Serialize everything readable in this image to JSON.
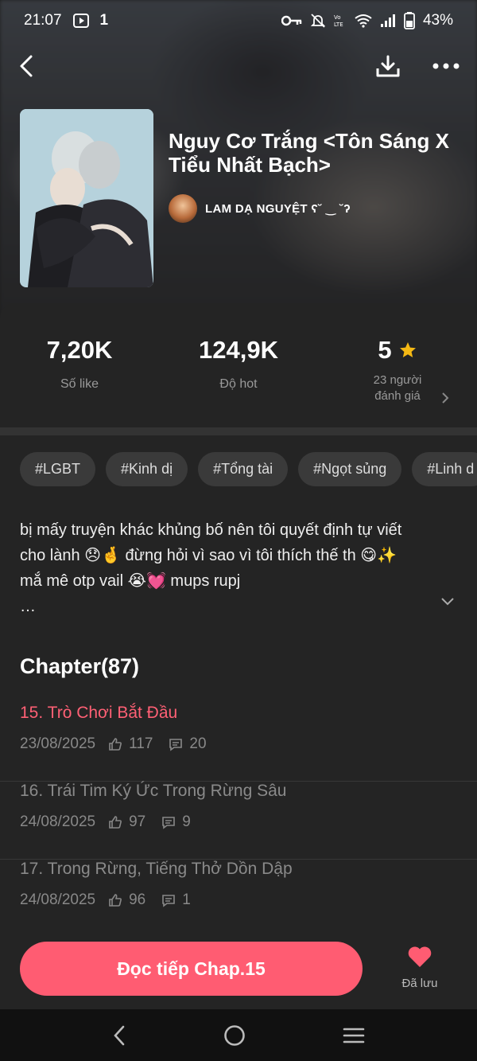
{
  "status_bar": {
    "time": "21:07",
    "notif_count": "1",
    "battery": "43%"
  },
  "book": {
    "title": "Nguy Cơ Trắng <Tôn Sáng X Tiểu Nhất Bạch>",
    "author": "LAM DẠ NGUYỆT ʕ˘ ‿ ˘ʔ"
  },
  "stats": {
    "likes_value": "7,20K",
    "likes_label": "Số like",
    "hot_value": "124,9K",
    "hot_label": "Độ hot",
    "rating_value": "5",
    "rating_label_1": "23 người",
    "rating_label_2": "đánh giá"
  },
  "tags": [
    "#LGBT",
    "#Kinh dị",
    "#Tổng tài",
    "#Ngọt sủng",
    "#Linh d"
  ],
  "description": {
    "line1": "bị mấy truyện khác khủng bố nên tôi quyết định tự viết",
    "line2": "cho lành 😞🤞 đừng hỏi vì sao vì tôi thích thế th 😋✨",
    "line3": "mắ mê otp vail 😭💓 mups rupj",
    "line4": "…"
  },
  "chapters_header": "Chapter(87)",
  "chapters": [
    {
      "title": "15. Trò Chơi Bắt Đầu",
      "date": "23/08/2025",
      "likes": "117",
      "comments": "20",
      "active": true
    },
    {
      "title": "16. Trái Tim Ký Ức Trong Rừng Sâu",
      "date": "24/08/2025",
      "likes": "97",
      "comments": "9",
      "active": false
    },
    {
      "title": "17. Trong Rừng, Tiếng Thở Dồn Dập",
      "date": "24/08/2025",
      "likes": "96",
      "comments": "1",
      "active": false
    }
  ],
  "cta": {
    "continue_label": "Đọc tiếp Chap.15",
    "saved_label": "Đã lưu"
  },
  "colors": {
    "accent": "#ff5c72",
    "active_chapter": "#ff6075",
    "star": "#f5b914"
  }
}
